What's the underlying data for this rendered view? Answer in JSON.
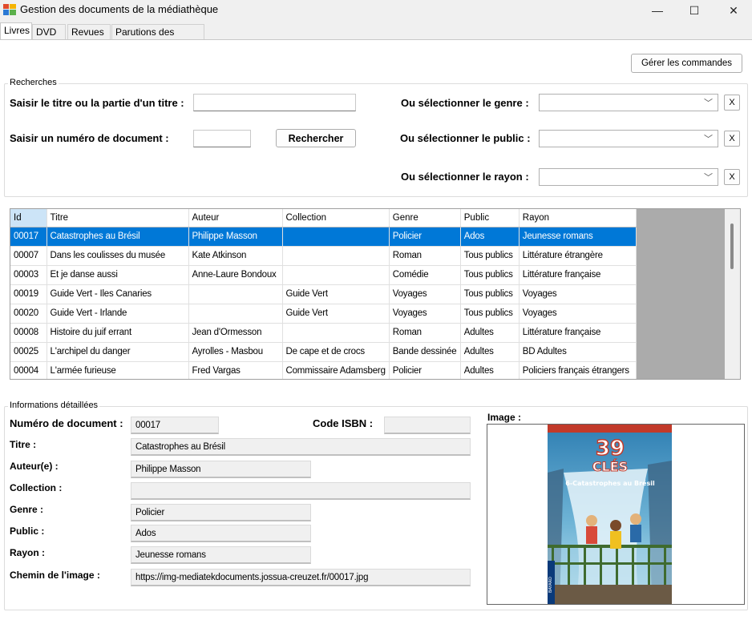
{
  "window": {
    "title": "Gestion des documents de la médiathèque",
    "minimize": "—",
    "maximize": "☐",
    "close": "✕"
  },
  "tabs": [
    {
      "label": "Livres",
      "active": true
    },
    {
      "label": "DVD"
    },
    {
      "label": "Revues"
    },
    {
      "label": "Parutions des revues"
    }
  ],
  "toolbar": {
    "manage_orders": "Gérer les commandes"
  },
  "search": {
    "group_title": "Recherches",
    "title_label": "Saisir le titre ou la partie d'un titre :",
    "title_value": "",
    "number_label": "Saisir un numéro de document :",
    "number_value": "",
    "search_button": "Rechercher",
    "genre_label": "Ou sélectionner le genre :",
    "public_label": "Ou sélectionner le public :",
    "rayon_label": "Ou sélectionner le rayon :",
    "genre_value": "",
    "public_value": "",
    "rayon_value": "",
    "clear_label": "X",
    "chevron": "﹀"
  },
  "grid": {
    "columns": [
      "Id",
      "Titre",
      "Auteur",
      "Collection",
      "Genre",
      "Public",
      "Rayon"
    ],
    "rows": [
      [
        "00017",
        "Catastrophes au Brésil",
        "Philippe Masson",
        "",
        "Policier",
        "Ados",
        "Jeunesse romans"
      ],
      [
        "00007",
        "Dans les coulisses du musée",
        "Kate Atkinson",
        "",
        "Roman",
        "Tous publics",
        "Littérature étrangère"
      ],
      [
        "00003",
        "Et je danse aussi",
        "Anne-Laure Bondoux",
        "",
        "Comédie",
        "Tous publics",
        "Littérature française"
      ],
      [
        "00019",
        "Guide Vert - Iles Canaries",
        "",
        "Guide Vert",
        "Voyages",
        "Tous publics",
        "Voyages"
      ],
      [
        "00020",
        "Guide Vert - Irlande",
        "",
        "Guide Vert",
        "Voyages",
        "Tous publics",
        "Voyages"
      ],
      [
        "00008",
        "Histoire du juif errant",
        "Jean d'Ormesson",
        "",
        "Roman",
        "Adultes",
        "Littérature française"
      ],
      [
        "00025",
        "L'archipel du danger",
        "Ayrolles - Masbou",
        "De cape et de crocs",
        "Bande dessinée",
        "Adultes",
        "BD Adultes"
      ],
      [
        "00004",
        "L'armée furieuse",
        "Fred Vargas",
        "Commissaire Adamsberg",
        "Policier",
        "Adultes",
        "Policiers français étrangers"
      ]
    ]
  },
  "details": {
    "group_title": "Informations détaillées",
    "number_label": "Numéro de document :",
    "number_value": "00017",
    "isbn_label": "Code ISBN :",
    "isbn_value": "",
    "title_label": "Titre :",
    "title_value": "Catastrophes au Brésil",
    "author_label": "Auteur(e) :",
    "author_value": "Philippe Masson",
    "collection_label": "Collection :",
    "collection_value": "",
    "genre_label": "Genre :",
    "genre_value": "Policier",
    "public_label": "Public :",
    "public_value": "Ados",
    "rayon_label": "Rayon :",
    "rayon_value": "Jeunesse romans",
    "path_label": "Chemin de l'image :",
    "path_value": "https://img-mediatekdocuments.jossua-creuzet.fr/00017.jpg",
    "image_label": "Image :"
  },
  "cover": {
    "series": "39",
    "series_word": "CLÉS",
    "subtitle": "6-Catastrophes au Brésil",
    "publisher": "BAYARD",
    "colors": {
      "sky": "#2f7fb3",
      "water": "#a9d6e8",
      "bridge": "#3f6b2f",
      "top": "#c23a2a"
    }
  }
}
